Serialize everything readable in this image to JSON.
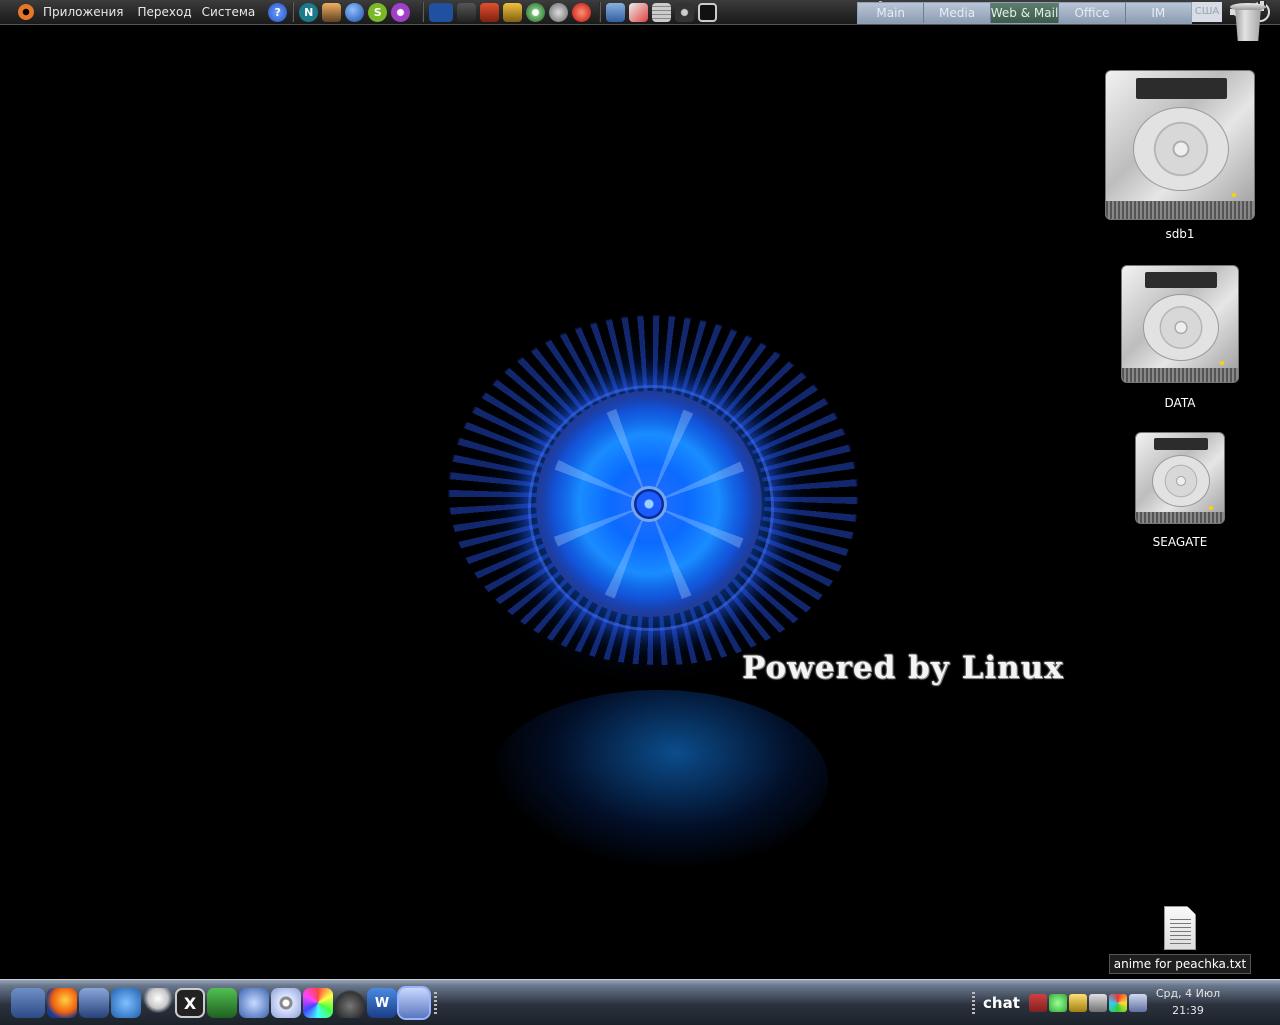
{
  "top_panel": {
    "menus": [
      "Приложения",
      "Переход",
      "Система"
    ],
    "launcher_icons": [
      "help-icon",
      "nero-icon",
      "inkscape-icon",
      "google-earth-icon",
      "skype-icon",
      "media-player-icon"
    ],
    "launcher_icons_2": [
      "text-editor-icon",
      "video-editor-icon",
      "image-viewer-icon",
      "movie-maker-icon",
      "disc-burner-icon",
      "film-reel-icon",
      "firefox-red-icon"
    ],
    "launcher_icons_3": [
      "screenshot-icon",
      "graphics-edit-icon",
      "calculator-icon",
      "camera-icon",
      "terminal-icon"
    ],
    "workspaces": [
      {
        "label": "Main",
        "active": false
      },
      {
        "label": "Media",
        "active": false
      },
      {
        "label": "Web & Mail",
        "active": true
      },
      {
        "label": "Office",
        "active": false
      },
      {
        "label": "IM",
        "active": false
      }
    ],
    "keyboard_layout": "США"
  },
  "wallpaper": {
    "caption": "Powered by Linux",
    "accent": "#1a6cff"
  },
  "desktop_icons": [
    {
      "label": "sdb1"
    },
    {
      "label": "DATA"
    },
    {
      "label": "SEAGATE"
    }
  ],
  "desktop_file": {
    "label": "anime for peachka.txt"
  },
  "bottom_panel": {
    "dock_icons": [
      "show-desktop-icon",
      "firefox-icon",
      "email-icon",
      "messenger-icon",
      "bulb-icon",
      "x-icon",
      "download-icon",
      "thunderbird-icon",
      "cd-icon",
      "color-picker-icon",
      "gimp-icon",
      "writer-icon",
      "pointer-icon"
    ],
    "tray_chat_label": "chat",
    "tray_icons": [
      "network-monitor-icon",
      "people-icon",
      "users-icon",
      "feather-icon",
      "ring-icon",
      "network-icon"
    ],
    "clock_date": "Срд,  4 Июл",
    "clock_time": "21:39"
  }
}
